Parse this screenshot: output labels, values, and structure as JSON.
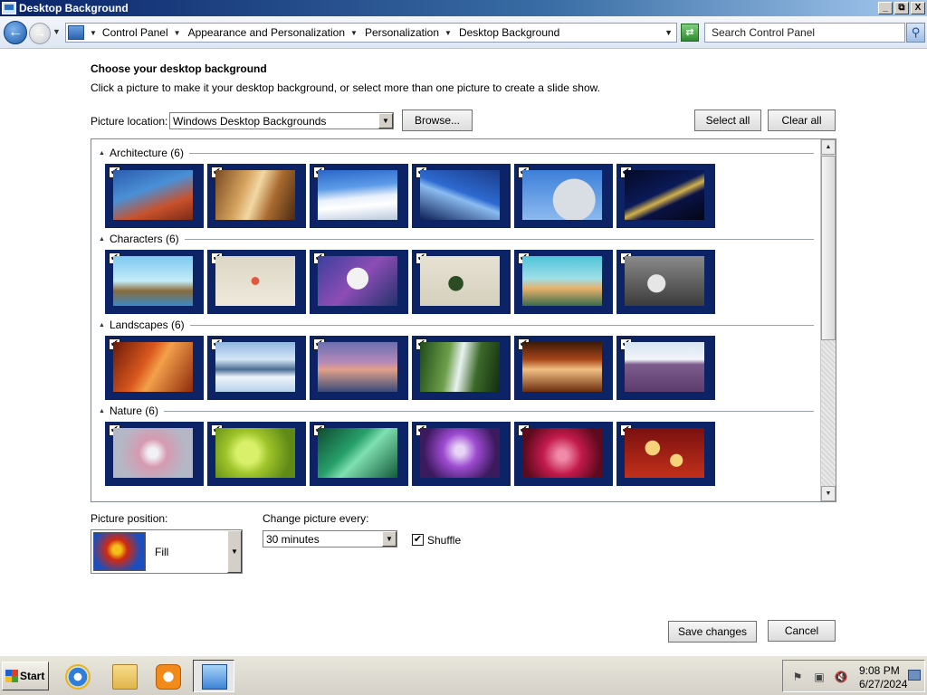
{
  "window": {
    "title": "Desktop Background",
    "controls": [
      "_",
      "⧉",
      "X"
    ]
  },
  "nav": {
    "breadcrumbs": [
      "Control Panel",
      "Appearance and Personalization",
      "Personalization",
      "Desktop Background"
    ],
    "search_placeholder": "Search Control Panel"
  },
  "content": {
    "heading": "Choose your desktop background",
    "subheading": "Click a picture to make it your desktop background, or select more than one picture to create a slide show.",
    "location_label": "Picture location:",
    "location_value": "Windows Desktop Backgrounds",
    "browse_label": "Browse...",
    "select_all_label": "Select all",
    "clear_all_label": "Clear all"
  },
  "gallery": {
    "groups": [
      {
        "name": "Architecture (6)",
        "items": [
          "arch1",
          "arch2",
          "arch3",
          "arch4",
          "arch5",
          "arch6"
        ]
      },
      {
        "name": "Characters (6)",
        "items": [
          "char1",
          "char2",
          "char3",
          "char4",
          "char5",
          "char6"
        ]
      },
      {
        "name": "Landscapes (6)",
        "items": [
          "land1",
          "land2",
          "land3",
          "land4",
          "land5",
          "land6"
        ]
      },
      {
        "name": "Nature (6)",
        "items": [
          "nat1",
          "nat2",
          "nat3",
          "nat4",
          "nat5",
          "nat6"
        ]
      }
    ],
    "checkmark": "✔"
  },
  "bottom": {
    "position_label": "Picture position:",
    "position_value": "Fill",
    "change_label": "Change picture every:",
    "change_value": "30 minutes",
    "shuffle_label": "Shuffle",
    "shuffle_checked": true,
    "save_label": "Save changes",
    "cancel_label": "Cancel"
  },
  "taskbar": {
    "start_label": "Start",
    "time": "9:08 PM",
    "date": "6/27/2024"
  }
}
